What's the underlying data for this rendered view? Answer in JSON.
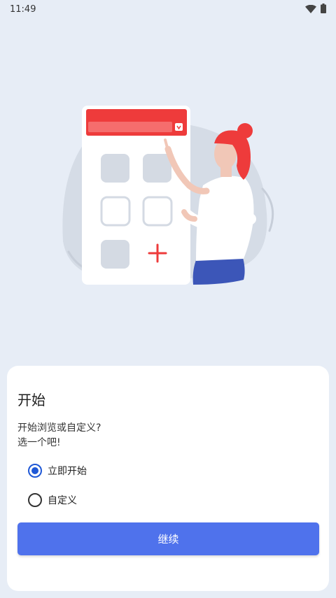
{
  "status_bar": {
    "time": "11:49",
    "icons": [
      "wifi-icon",
      "battery-icon"
    ]
  },
  "illustration": {
    "description_icon": "phone-app-grid-illustration"
  },
  "dialog": {
    "title": "开始",
    "description_line1": "开始浏览或自定义?",
    "description_line2": "选一个吧!",
    "options": [
      {
        "label": "立即开始",
        "selected": true
      },
      {
        "label": "自定义",
        "selected": false
      }
    ],
    "continue_label": "继续"
  },
  "colors": {
    "background": "#e7edf6",
    "accent": "#4f72ec",
    "radio_selected": "#1f58d6",
    "illustration_red": "#ee3b3b"
  }
}
